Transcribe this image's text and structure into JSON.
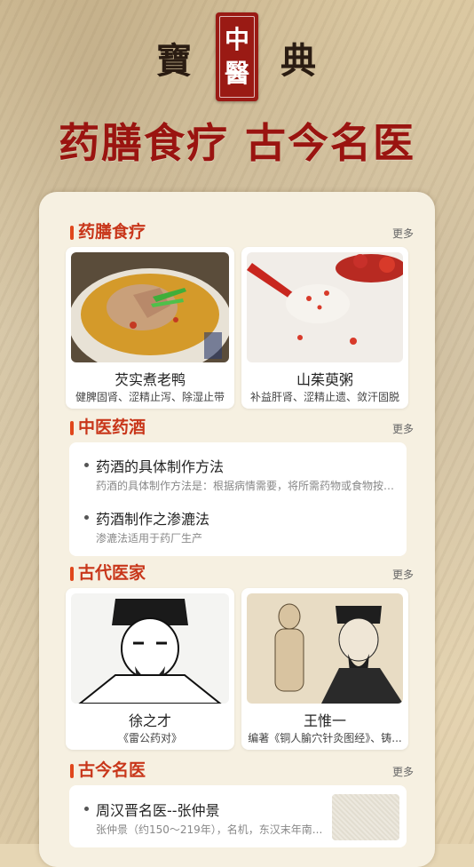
{
  "header": {
    "left_char": "寶",
    "seal_top": "中",
    "seal_bottom": "醫",
    "right_char": "典",
    "slogan": "药膳食疗  古今名医"
  },
  "sections": {
    "diet": {
      "title": "药膳食疗",
      "more": "更多",
      "items": [
        {
          "name": "芡实煮老鸭",
          "desc": "健脾固肾、涩精止泻、除湿止带"
        },
        {
          "name": "山茱萸粥",
          "desc": "补益肝肾、涩精止遗、敛汗固脱"
        }
      ]
    },
    "wine": {
      "title": "中医药酒",
      "more": "更多",
      "items": [
        {
          "title": "药酒的具体制作方法",
          "desc": "药酒的具体制作方法是：根据病情需要，将所需药物或食物按处..."
        },
        {
          "title": "药酒制作之渗漉法",
          "desc": "渗漉法适用于药厂生产"
        }
      ]
    },
    "doctors": {
      "title": "古代医家",
      "more": "更多",
      "items": [
        {
          "name": "徐之才",
          "desc": "《雷公药对》"
        },
        {
          "name": "王惟一",
          "desc": "编著《铜人腧穴针灸图经》、铸..."
        }
      ]
    },
    "famous": {
      "title": "古今名医",
      "more": "更多",
      "items": [
        {
          "title": "周汉晋名医--张仲景",
          "desc": "张仲景（约150～219年），名机，东汉末年南..."
        }
      ]
    }
  },
  "colors": {
    "accent": "#c8361a",
    "seal": "#9a1a14",
    "panel": "#f6f0e1"
  }
}
